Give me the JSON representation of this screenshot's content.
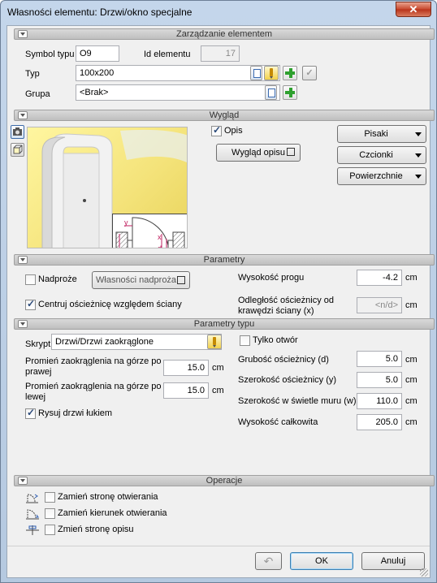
{
  "window": {
    "title": "Własności elementu: Drzwi/okno specjalne",
    "close_glyph": "✕"
  },
  "sections": {
    "zarzadzanie": "Zarządzanie elementem",
    "wyglad": "Wygląd",
    "parametry": "Parametry",
    "parametry_typu": "Parametry typu",
    "operacje": "Operacje"
  },
  "element": {
    "symbol_label": "Symbol typu",
    "symbol_value": "O9",
    "id_label": "Id elementu",
    "id_value": "17",
    "typ_label": "Typ",
    "typ_value": "100x200",
    "grupa_label": "Grupa",
    "grupa_value": "<Brak>"
  },
  "wyglad": {
    "opis_label": "Opis",
    "opis_checked": true,
    "wyglad_opisu_button": "Wygląd opisu",
    "pisaki_button": "Pisaki",
    "czcionki_button": "Czcionki",
    "powierzchnie_button": "Powierzchnie",
    "diagram_labels": {
      "y": "y",
      "x": "x",
      "d": "d",
      "w": "w"
    }
  },
  "parametry": {
    "nadproze_label": "Nadproże",
    "nadproze_checked": false,
    "wlasnosci_nadproza_button": "Własności nadproża",
    "centruj_label": "Centruj ościeżnicę względem ściany",
    "centruj_checked": true,
    "wysokosc_progu_label": "Wysokość progu",
    "wysokosc_progu_value": "-4.2",
    "odleglosc_label_line1": "Odległość ościeżnicy od",
    "odleglosc_label_line2": "krawędzi ściany (x)",
    "odleglosc_value": "<n/d>",
    "unit": "cm"
  },
  "parametry_typu": {
    "skrypt_label": "Skrypt",
    "skrypt_value": "Drzwi/Drzwi zaokrąglone",
    "promien_prawej_line1": "Promień zaokrąglenia na górze po",
    "promien_prawej_line2": "prawej",
    "promien_prawej_value": "15.0",
    "promien_lewej_line1": "Promień zaokrąglenia na górze po",
    "promien_lewej_line2": "lewej",
    "promien_lewej_value": "15.0",
    "rysuj_label": "Rysuj drzwi łukiem",
    "rysuj_checked": true,
    "tylko_otwor_label": "Tylko otwór",
    "tylko_otwor_checked": false,
    "grubosc_label": "Grubość ościeżnicy (d)",
    "grubosc_value": "5.0",
    "szerokosc_label": "Szerokość ościeżnicy (y)",
    "szerokosc_value": "5.0",
    "szerokosc_swietle_label": "Szerokość w świetle muru (w)",
    "szerokosc_swietle_value": "110.0",
    "wysokosc_label": "Wysokość całkowita",
    "wysokosc_value": "205.0",
    "unit": "cm"
  },
  "operacje": {
    "items": [
      {
        "label": "Zamień stronę otwierania",
        "checked": false
      },
      {
        "label": "Zamień kierunek otwierania",
        "checked": false
      },
      {
        "label": "Zmień stronę opisu",
        "checked": false
      }
    ]
  },
  "footer": {
    "ok": "OK",
    "cancel": "Anuluj",
    "undo_glyph": "↶"
  }
}
